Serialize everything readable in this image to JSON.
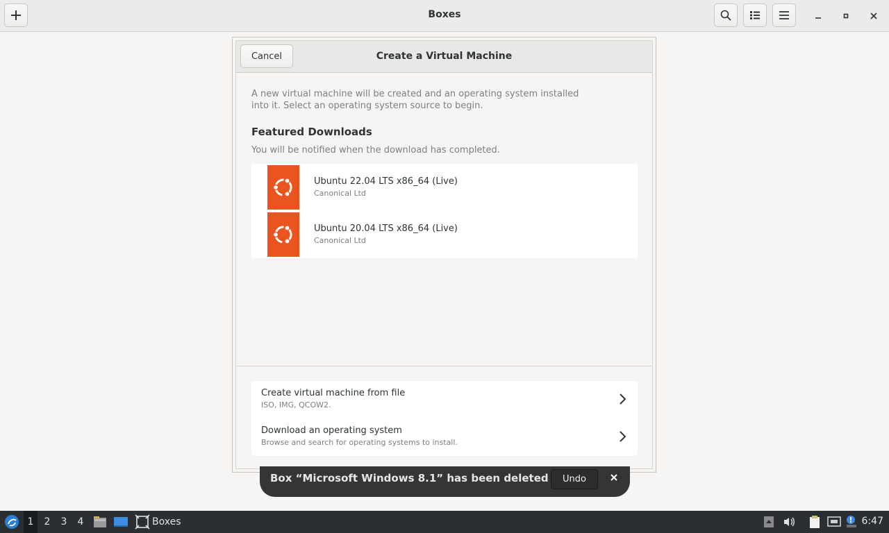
{
  "window": {
    "title": "Boxes"
  },
  "dialog": {
    "cancel_label": "Cancel",
    "title": "Create a Virtual Machine",
    "intro_line1": "A new virtual machine will be created and an operating system installed",
    "intro_line2": "into it. Select an operating system source to begin.",
    "featured_title": "Featured Downloads",
    "featured_subtitle": "You will be notified when the download has completed.",
    "featured": [
      {
        "name": "Ubuntu 22.04 LTS x86_64 (Live)",
        "vendor": "Canonical Ltd"
      },
      {
        "name": "Ubuntu 20.04 LTS x86_64 (Live)",
        "vendor": "Canonical Ltd"
      }
    ],
    "actions": [
      {
        "title": "Create virtual machine from file",
        "subtitle": "ISO, IMG, QCOW2."
      },
      {
        "title": "Download an operating system",
        "subtitle": "Browse and search for operating systems to install."
      }
    ]
  },
  "toast": {
    "message": "Box “Microsoft Windows 8.1” has been deleted",
    "undo_label": "Undo"
  },
  "taskbar": {
    "workspaces": [
      "1",
      "2",
      "3",
      "4"
    ],
    "active_workspace": "1",
    "app_label": "Boxes",
    "clock": "6:47"
  },
  "colors": {
    "ubuntu_orange": "#e95420",
    "taskbar_bg": "#2b2f33",
    "toast_bg": "#353535"
  }
}
